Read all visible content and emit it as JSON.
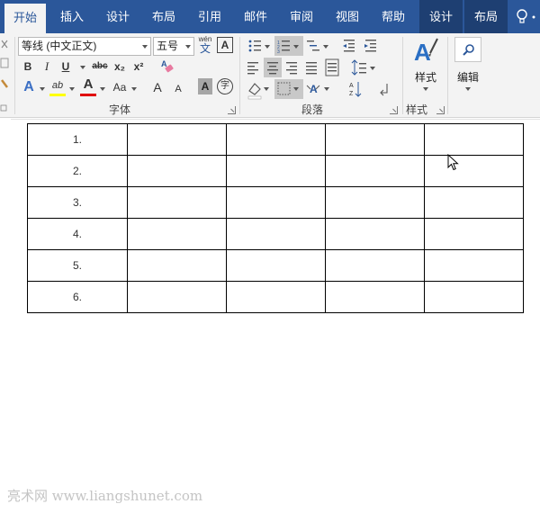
{
  "tabs": [
    {
      "label": "开始",
      "active": true
    },
    {
      "label": "插入"
    },
    {
      "label": "设计"
    },
    {
      "label": "布局"
    },
    {
      "label": "引用"
    },
    {
      "label": "邮件"
    },
    {
      "label": "审阅"
    },
    {
      "label": "视图"
    },
    {
      "label": "帮助"
    },
    {
      "label": "设计",
      "contextual": true
    },
    {
      "label": "布局",
      "contextual": true
    }
  ],
  "ribbon": {
    "font": {
      "font_name": "等线 (中文正文)",
      "font_size": "五号",
      "phonetic_top": "wén",
      "phonetic_bottom": "文",
      "char_border": "A",
      "bold": "B",
      "italic": "I",
      "underline": "U",
      "strike": "abc",
      "subscript": "x₂",
      "superscript": "x²",
      "text_effect": "A",
      "highlight": "ab",
      "font_color": "A",
      "change_case": "Aa",
      "grow": "A",
      "shrink": "A",
      "char_shading": "A",
      "enclose": "字",
      "label": "字体"
    },
    "paragraph": {
      "label": "段落"
    },
    "styles": {
      "button": "样式",
      "label": "样式"
    },
    "editing": {
      "button": "编辑"
    }
  },
  "colors": {
    "brand": "#2b579a",
    "highlight": "#ffff00",
    "font_color": "#e00000"
  },
  "table": {
    "rows": [
      "1.",
      "2.",
      "3.",
      "4.",
      "5.",
      "6."
    ]
  },
  "watermark": "亮术网 www.liangshunet.com"
}
